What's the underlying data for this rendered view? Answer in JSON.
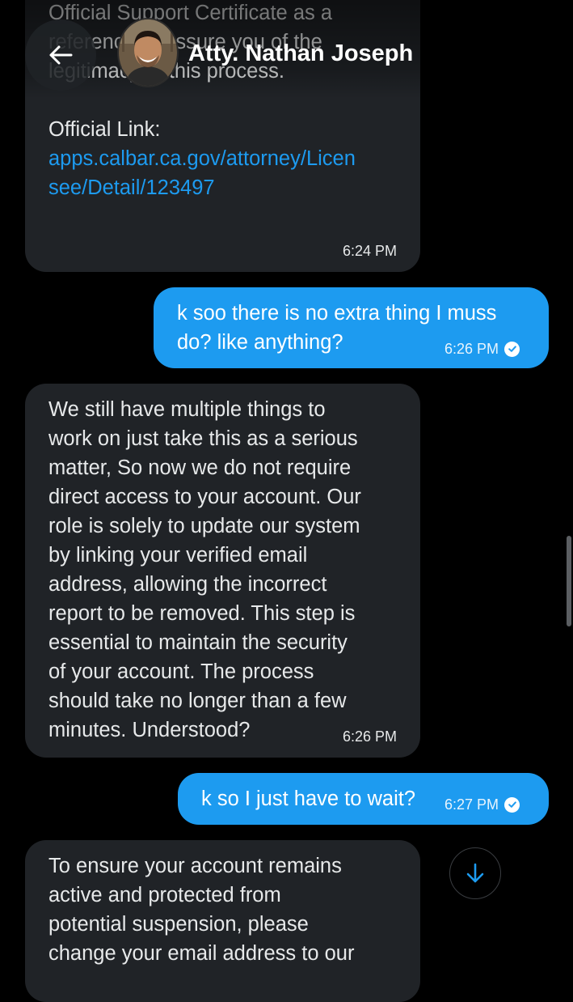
{
  "header": {
    "contact_name": "Atty. Nathan Joseph"
  },
  "messages": [
    {
      "direction": "incoming",
      "lines": [
        "Official Support Certificate as a",
        "reference to assure you of the",
        "legitimacy of this process.",
        "",
        "Official Link:"
      ],
      "link_lines": [
        "apps.calbar.ca.gov/attorney/Licen",
        "see/Detail/123497"
      ],
      "time": "6:24 PM"
    },
    {
      "direction": "outgoing",
      "lines": [
        "k soo there is no extra thing I muss",
        "do? like anything?"
      ],
      "time": "6:26 PM"
    },
    {
      "direction": "incoming",
      "lines": [
        "We still have multiple things to",
        "work on just take this as a serious",
        "matter, So now we do not require",
        "direct access to your account. Our",
        "role is solely to update our system",
        "by linking your verified email",
        "address, allowing the incorrect",
        "report to be removed. This step is",
        "essential to maintain the security",
        "of your account. The process",
        "should take no longer than a few",
        "minutes. Understood?"
      ],
      "time": "6:26 PM"
    },
    {
      "direction": "outgoing",
      "lines": [
        "k so I just have to wait?"
      ],
      "time": "6:27 PM"
    },
    {
      "direction": "incoming",
      "lines": [
        "To ensure your account remains",
        "active and protected from",
        "potential suspension, please",
        "change your email address to our"
      ],
      "time": ""
    }
  ],
  "icons": {
    "back": "arrow-left-icon",
    "read_receipt": "check-circle-icon",
    "scroll_down": "arrow-down-icon"
  },
  "colors": {
    "background": "#000000",
    "incoming_bubble": "#202327",
    "outgoing_bubble": "#1d9bf0",
    "link": "#1d9bf0",
    "text": "#e7e9ea"
  }
}
